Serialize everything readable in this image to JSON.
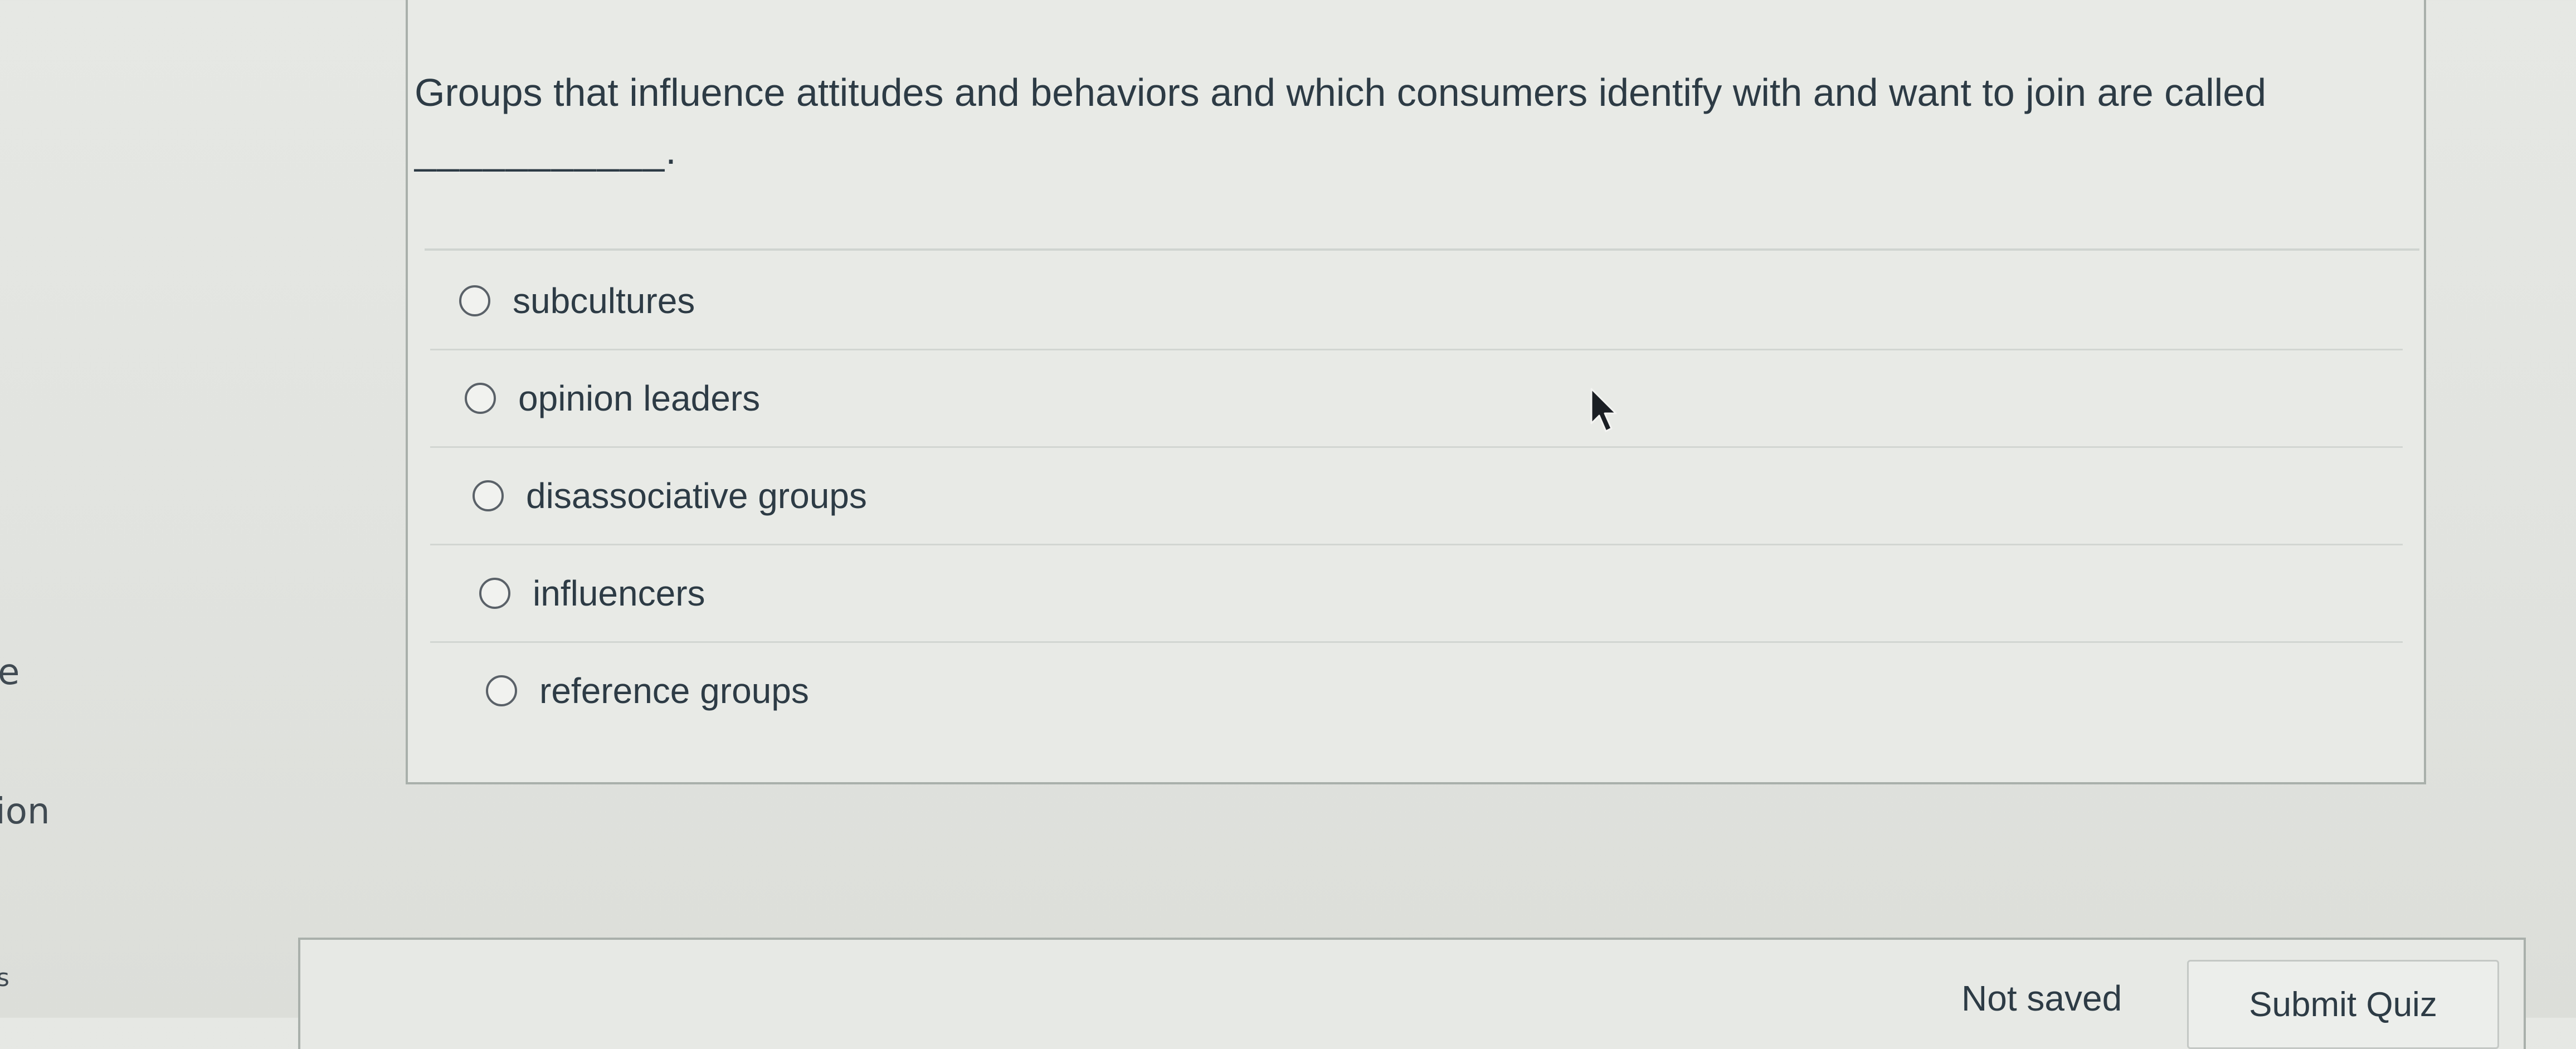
{
  "sidebar_fragments": {
    "frag_1": "e",
    "frag_2": "ion",
    "frag_3": "s"
  },
  "question": {
    "text_before_blank": "Groups that influence attitudes and behaviors and which consumers identify with and want to join are called ",
    "blank": "___________",
    "text_after_blank": "."
  },
  "answers": [
    {
      "label": "subcultures",
      "selected": false
    },
    {
      "label": "opinion leaders",
      "selected": false
    },
    {
      "label": "disassociative groups",
      "selected": false
    },
    {
      "label": "influencers",
      "selected": false
    },
    {
      "label": "reference groups",
      "selected": false
    }
  ],
  "footer": {
    "save_status": "Not saved",
    "submit_label": "Submit Quiz"
  },
  "icons": {
    "cursor": "mouse-pointer-icon",
    "radio": "radio-circle-icon"
  }
}
